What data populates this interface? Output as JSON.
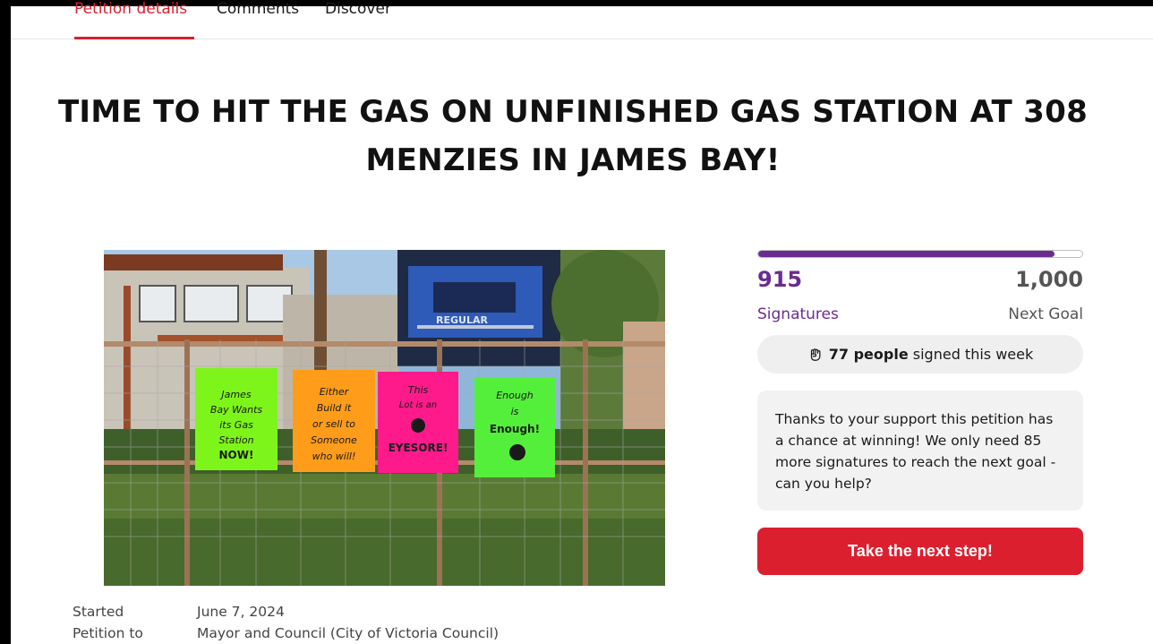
{
  "tabs": [
    {
      "label": "Petition details",
      "active": true
    },
    {
      "label": "Comments",
      "active": false
    },
    {
      "label": "Discover",
      "active": false
    }
  ],
  "petition": {
    "title": "TIME TO HIT THE GAS ON UNFINISHED GAS STATION AT 308 MENZIES IN JAMES BAY!",
    "image_alt": "Fence with protest signs in front of an unfinished gas station",
    "image_text": {
      "pump_sign": "REGULAR",
      "sign1": "James Bay Wants its Gas Station NOW!",
      "sign2": "Either Build it or sell to Someone who will!",
      "sign3": "This Lot is an EYESORE!",
      "sign4": "Enough is Enough!"
    }
  },
  "signatures": {
    "count": "915",
    "count_label": "Signatures",
    "goal": "1,000",
    "goal_label": "Next Goal",
    "progress_fraction": 0.915,
    "weekly_strong": "77 people",
    "weekly_rest": "signed this week",
    "weekly_icon": "fist-icon"
  },
  "support_message": "Thanks to your support this petition has a chance at winning! We only need 85 more signatures to reach the next goal - can you help?",
  "cta_label": "Take the next step!",
  "meta": {
    "started_label": "Started",
    "started_value": "June 7, 2024",
    "petition_to_label": "Petition to",
    "petition_to_value": "Mayor and Council (City of Victoria Council)"
  },
  "colors": {
    "accent_red": "#dc1f2e",
    "signature_purple": "#6a2c91"
  }
}
